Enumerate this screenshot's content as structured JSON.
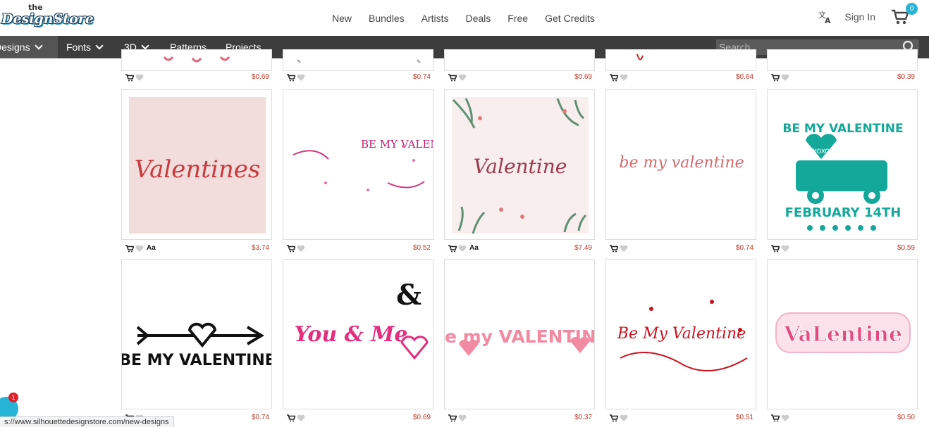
{
  "header": {
    "logo": {
      "small": "the",
      "word": "DesignStore"
    },
    "nav": [
      "New",
      "Bundles",
      "Artists",
      "Deals",
      "Free",
      "Get Credits"
    ],
    "sign_in": "Sign In",
    "cart_count": "0"
  },
  "categories": [
    {
      "label": "Designs",
      "dropdown": true,
      "active": true
    },
    {
      "label": "Fonts",
      "dropdown": true
    },
    {
      "label": "3D",
      "dropdown": true
    },
    {
      "label": "Patterns",
      "dropdown": false
    },
    {
      "label": "Projects",
      "dropdown": false
    }
  ],
  "search": {
    "placeholder": "Search"
  },
  "rows": [
    {
      "prices": [
        "$0.69",
        "$0.74",
        "$0.69",
        "$0.64",
        "$0.39"
      ],
      "font_badge": [
        false,
        false,
        false,
        false,
        false
      ]
    },
    {
      "prices": [
        "$3.74",
        "$0.52",
        "$7.49",
        "$0.74",
        "$0.59"
      ],
      "font_badge": [
        true,
        false,
        true,
        false,
        false
      ],
      "titles": [
        "Valentines",
        "BE MY VALENTINE?",
        "Valentine",
        "be my valentine",
        "BE MY VALENTINE"
      ]
    },
    {
      "prices": [
        "$0.74",
        "$0.69",
        "$0.37",
        "$0.51",
        "$0.50"
      ],
      "font_badge": [
        false,
        false,
        false,
        false,
        false
      ],
      "titles": [
        "BE MY VALENTINE",
        "You & Me",
        "be my VALENTINE",
        "Be My Valentine",
        "VaLentine"
      ]
    }
  ],
  "card_texts": {
    "truck_sub": "FEBRUARY 14TH",
    "truck_heart": "XOXO",
    "amp": "&"
  },
  "font_badge_label": "Aa",
  "statusbar_url": "s://www.silhouettedesignstore.com/new-designs",
  "chat_badge": "1",
  "colors": {
    "accent": "#25b4d6",
    "price": "#c0392b",
    "catbar": "#3d3d3d"
  }
}
